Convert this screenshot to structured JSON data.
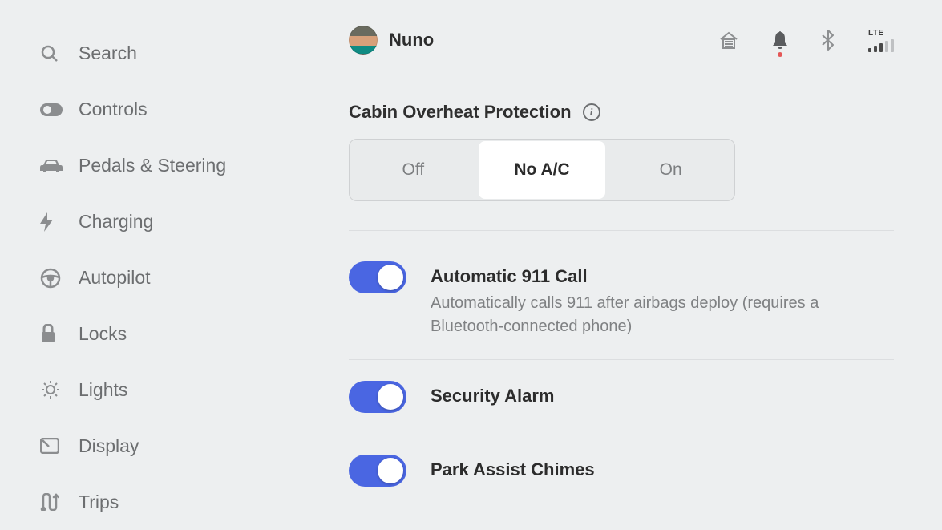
{
  "sidebar": {
    "items": [
      {
        "label": "Search"
      },
      {
        "label": "Controls"
      },
      {
        "label": "Pedals & Steering"
      },
      {
        "label": "Charging"
      },
      {
        "label": "Autopilot"
      },
      {
        "label": "Locks"
      },
      {
        "label": "Lights"
      },
      {
        "label": "Display"
      },
      {
        "label": "Trips"
      }
    ]
  },
  "header": {
    "profile_name": "Nuno",
    "signal_label": "LTE"
  },
  "settings": {
    "cabin_overheat": {
      "title": "Cabin Overheat Protection",
      "options": [
        "Off",
        "No A/C",
        "On"
      ],
      "selected_index": 1
    },
    "auto_911": {
      "title": "Automatic 911 Call",
      "description": "Automatically calls 911 after airbags deploy (requires a Bluetooth-connected phone)",
      "enabled": true
    },
    "security_alarm": {
      "title": "Security Alarm",
      "enabled": true
    },
    "park_assist": {
      "title": "Park Assist Chimes",
      "enabled": true
    }
  }
}
